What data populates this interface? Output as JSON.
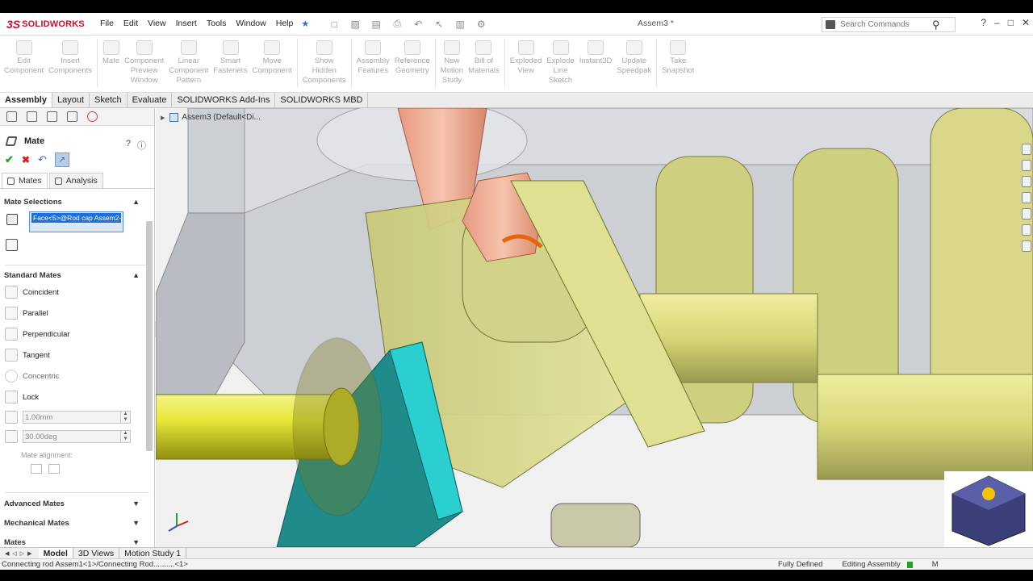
{
  "app": {
    "logo_text": "SOLIDWORKS",
    "document_title": "Assem3 *"
  },
  "menu": [
    "File",
    "Edit",
    "View",
    "Insert",
    "Tools",
    "Window",
    "Help"
  ],
  "search": {
    "placeholder": "Search Commands"
  },
  "window_controls": [
    "?",
    "–",
    "□",
    "✕"
  ],
  "command_manager": [
    {
      "label": "Edit\nComponent",
      "icon": "edit-component-icon"
    },
    {
      "label": "Insert\nComponents",
      "icon": "insert-components-icon"
    },
    {
      "label": "Mate",
      "icon": "mate-icon"
    },
    {
      "label": "Component\nPreview\nWindow",
      "icon": "preview-window-icon"
    },
    {
      "label": "Linear\nComponent\nPattern",
      "icon": "linear-pattern-icon"
    },
    {
      "label": "Smart\nFasteners",
      "icon": "fasteners-icon"
    },
    {
      "label": "Move\nComponent",
      "icon": "move-component-icon"
    },
    {
      "label": "Show\nHidden\nComponents",
      "icon": "show-hidden-icon"
    },
    {
      "label": "Assembly\nFeatures",
      "icon": "assembly-features-icon"
    },
    {
      "label": "Reference\nGeometry",
      "icon": "reference-geometry-icon"
    },
    {
      "label": "New\nMotion\nStudy",
      "icon": "motion-study-icon"
    },
    {
      "label": "Bill of\nMaterials",
      "icon": "bom-icon"
    },
    {
      "label": "Exploded\nView",
      "icon": "exploded-view-icon"
    },
    {
      "label": "Explode\nLine\nSketch",
      "icon": "explode-line-icon"
    },
    {
      "label": "Instant3D",
      "icon": "instant3d-icon"
    },
    {
      "label": "Update\nSpeedpak",
      "icon": "speedpak-icon"
    },
    {
      "label": "Take\nSnapshot",
      "icon": "snapshot-icon"
    }
  ],
  "tabs": [
    "Assembly",
    "Layout",
    "Sketch",
    "Evaluate",
    "SOLIDWORKS Add-Ins",
    "SOLIDWORKS MBD"
  ],
  "active_tab": "Assembly",
  "property_manager": {
    "title": "Mate",
    "subtabs": [
      "Mates",
      "Analysis"
    ],
    "mate_selections": {
      "header": "Mate Selections",
      "selected_item": "Face<5>@Rod cap Assem2-"
    },
    "standard_mates": {
      "header": "Standard Mates",
      "items": [
        {
          "label": "Coincident",
          "enabled": true
        },
        {
          "label": "Parallel",
          "enabled": true
        },
        {
          "label": "Perpendicular",
          "enabled": true
        },
        {
          "label": "Tangent",
          "enabled": true
        },
        {
          "label": "Concentric",
          "enabled": false
        },
        {
          "label": "Lock",
          "enabled": true
        }
      ],
      "distance_value": "1.00mm",
      "angle_value": "30.00deg",
      "alignment_label": "Mate alignment:"
    },
    "advanced_mates_header": "Advanced Mates",
    "mechanical_mates_header": "Mechanical Mates",
    "mates_header": "Mates"
  },
  "viewport": {
    "tree_root": "Assem3  (Default<Di..."
  },
  "bottom_tabs": [
    "Model",
    "3D Views",
    "Motion Study 1"
  ],
  "status": {
    "message": "Connecting rod Assem1<1>/Connecting Rod..........<1>",
    "definition": "Fully Defined",
    "mode": "Editing Assembly",
    "units": "M"
  },
  "colors": {
    "crank_yellow": "#d8d878",
    "rod_copper": "#e8a082",
    "block_teal": "#2aa8a8",
    "shaft_yellow": "#e8e840"
  }
}
